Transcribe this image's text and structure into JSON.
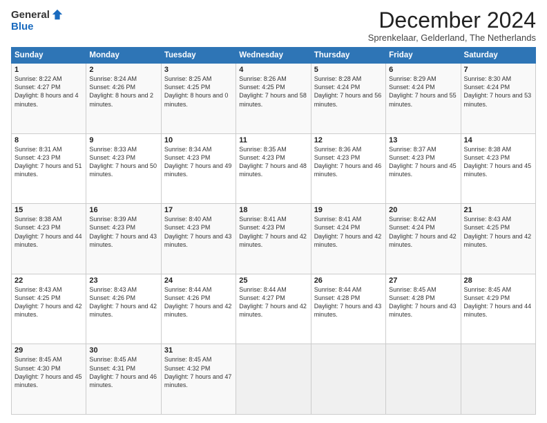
{
  "logo": {
    "general": "General",
    "blue": "Blue"
  },
  "title": "December 2024",
  "subtitle": "Sprenkelaar, Gelderland, The Netherlands",
  "header_days": [
    "Sunday",
    "Monday",
    "Tuesday",
    "Wednesday",
    "Thursday",
    "Friday",
    "Saturday"
  ],
  "weeks": [
    [
      {
        "day": 1,
        "sunrise": "8:22 AM",
        "sunset": "4:27 PM",
        "daylight": "8 hours and 4 minutes."
      },
      {
        "day": 2,
        "sunrise": "8:24 AM",
        "sunset": "4:26 PM",
        "daylight": "8 hours and 2 minutes."
      },
      {
        "day": 3,
        "sunrise": "8:25 AM",
        "sunset": "4:25 PM",
        "daylight": "8 hours and 0 minutes."
      },
      {
        "day": 4,
        "sunrise": "8:26 AM",
        "sunset": "4:25 PM",
        "daylight": "7 hours and 58 minutes."
      },
      {
        "day": 5,
        "sunrise": "8:28 AM",
        "sunset": "4:24 PM",
        "daylight": "7 hours and 56 minutes."
      },
      {
        "day": 6,
        "sunrise": "8:29 AM",
        "sunset": "4:24 PM",
        "daylight": "7 hours and 55 minutes."
      },
      {
        "day": 7,
        "sunrise": "8:30 AM",
        "sunset": "4:24 PM",
        "daylight": "7 hours and 53 minutes."
      }
    ],
    [
      {
        "day": 8,
        "sunrise": "8:31 AM",
        "sunset": "4:23 PM",
        "daylight": "7 hours and 51 minutes."
      },
      {
        "day": 9,
        "sunrise": "8:33 AM",
        "sunset": "4:23 PM",
        "daylight": "7 hours and 50 minutes."
      },
      {
        "day": 10,
        "sunrise": "8:34 AM",
        "sunset": "4:23 PM",
        "daylight": "7 hours and 49 minutes."
      },
      {
        "day": 11,
        "sunrise": "8:35 AM",
        "sunset": "4:23 PM",
        "daylight": "7 hours and 48 minutes."
      },
      {
        "day": 12,
        "sunrise": "8:36 AM",
        "sunset": "4:23 PM",
        "daylight": "7 hours and 46 minutes."
      },
      {
        "day": 13,
        "sunrise": "8:37 AM",
        "sunset": "4:23 PM",
        "daylight": "7 hours and 45 minutes."
      },
      {
        "day": 14,
        "sunrise": "8:38 AM",
        "sunset": "4:23 PM",
        "daylight": "7 hours and 45 minutes."
      }
    ],
    [
      {
        "day": 15,
        "sunrise": "8:38 AM",
        "sunset": "4:23 PM",
        "daylight": "7 hours and 44 minutes."
      },
      {
        "day": 16,
        "sunrise": "8:39 AM",
        "sunset": "4:23 PM",
        "daylight": "7 hours and 43 minutes."
      },
      {
        "day": 17,
        "sunrise": "8:40 AM",
        "sunset": "4:23 PM",
        "daylight": "7 hours and 43 minutes."
      },
      {
        "day": 18,
        "sunrise": "8:41 AM",
        "sunset": "4:23 PM",
        "daylight": "7 hours and 42 minutes."
      },
      {
        "day": 19,
        "sunrise": "8:41 AM",
        "sunset": "4:24 PM",
        "daylight": "7 hours and 42 minutes."
      },
      {
        "day": 20,
        "sunrise": "8:42 AM",
        "sunset": "4:24 PM",
        "daylight": "7 hours and 42 minutes."
      },
      {
        "day": 21,
        "sunrise": "8:43 AM",
        "sunset": "4:25 PM",
        "daylight": "7 hours and 42 minutes."
      }
    ],
    [
      {
        "day": 22,
        "sunrise": "8:43 AM",
        "sunset": "4:25 PM",
        "daylight": "7 hours and 42 minutes."
      },
      {
        "day": 23,
        "sunrise": "8:43 AM",
        "sunset": "4:26 PM",
        "daylight": "7 hours and 42 minutes."
      },
      {
        "day": 24,
        "sunrise": "8:44 AM",
        "sunset": "4:26 PM",
        "daylight": "7 hours and 42 minutes."
      },
      {
        "day": 25,
        "sunrise": "8:44 AM",
        "sunset": "4:27 PM",
        "daylight": "7 hours and 42 minutes."
      },
      {
        "day": 26,
        "sunrise": "8:44 AM",
        "sunset": "4:28 PM",
        "daylight": "7 hours and 43 minutes."
      },
      {
        "day": 27,
        "sunrise": "8:45 AM",
        "sunset": "4:28 PM",
        "daylight": "7 hours and 43 minutes."
      },
      {
        "day": 28,
        "sunrise": "8:45 AM",
        "sunset": "4:29 PM",
        "daylight": "7 hours and 44 minutes."
      }
    ],
    [
      {
        "day": 29,
        "sunrise": "8:45 AM",
        "sunset": "4:30 PM",
        "daylight": "7 hours and 45 minutes."
      },
      {
        "day": 30,
        "sunrise": "8:45 AM",
        "sunset": "4:31 PM",
        "daylight": "7 hours and 46 minutes."
      },
      {
        "day": 31,
        "sunrise": "8:45 AM",
        "sunset": "4:32 PM",
        "daylight": "7 hours and 47 minutes."
      },
      null,
      null,
      null,
      null
    ]
  ],
  "labels": {
    "sunrise": "Sunrise:",
    "sunset": "Sunset:",
    "daylight": "Daylight:"
  }
}
